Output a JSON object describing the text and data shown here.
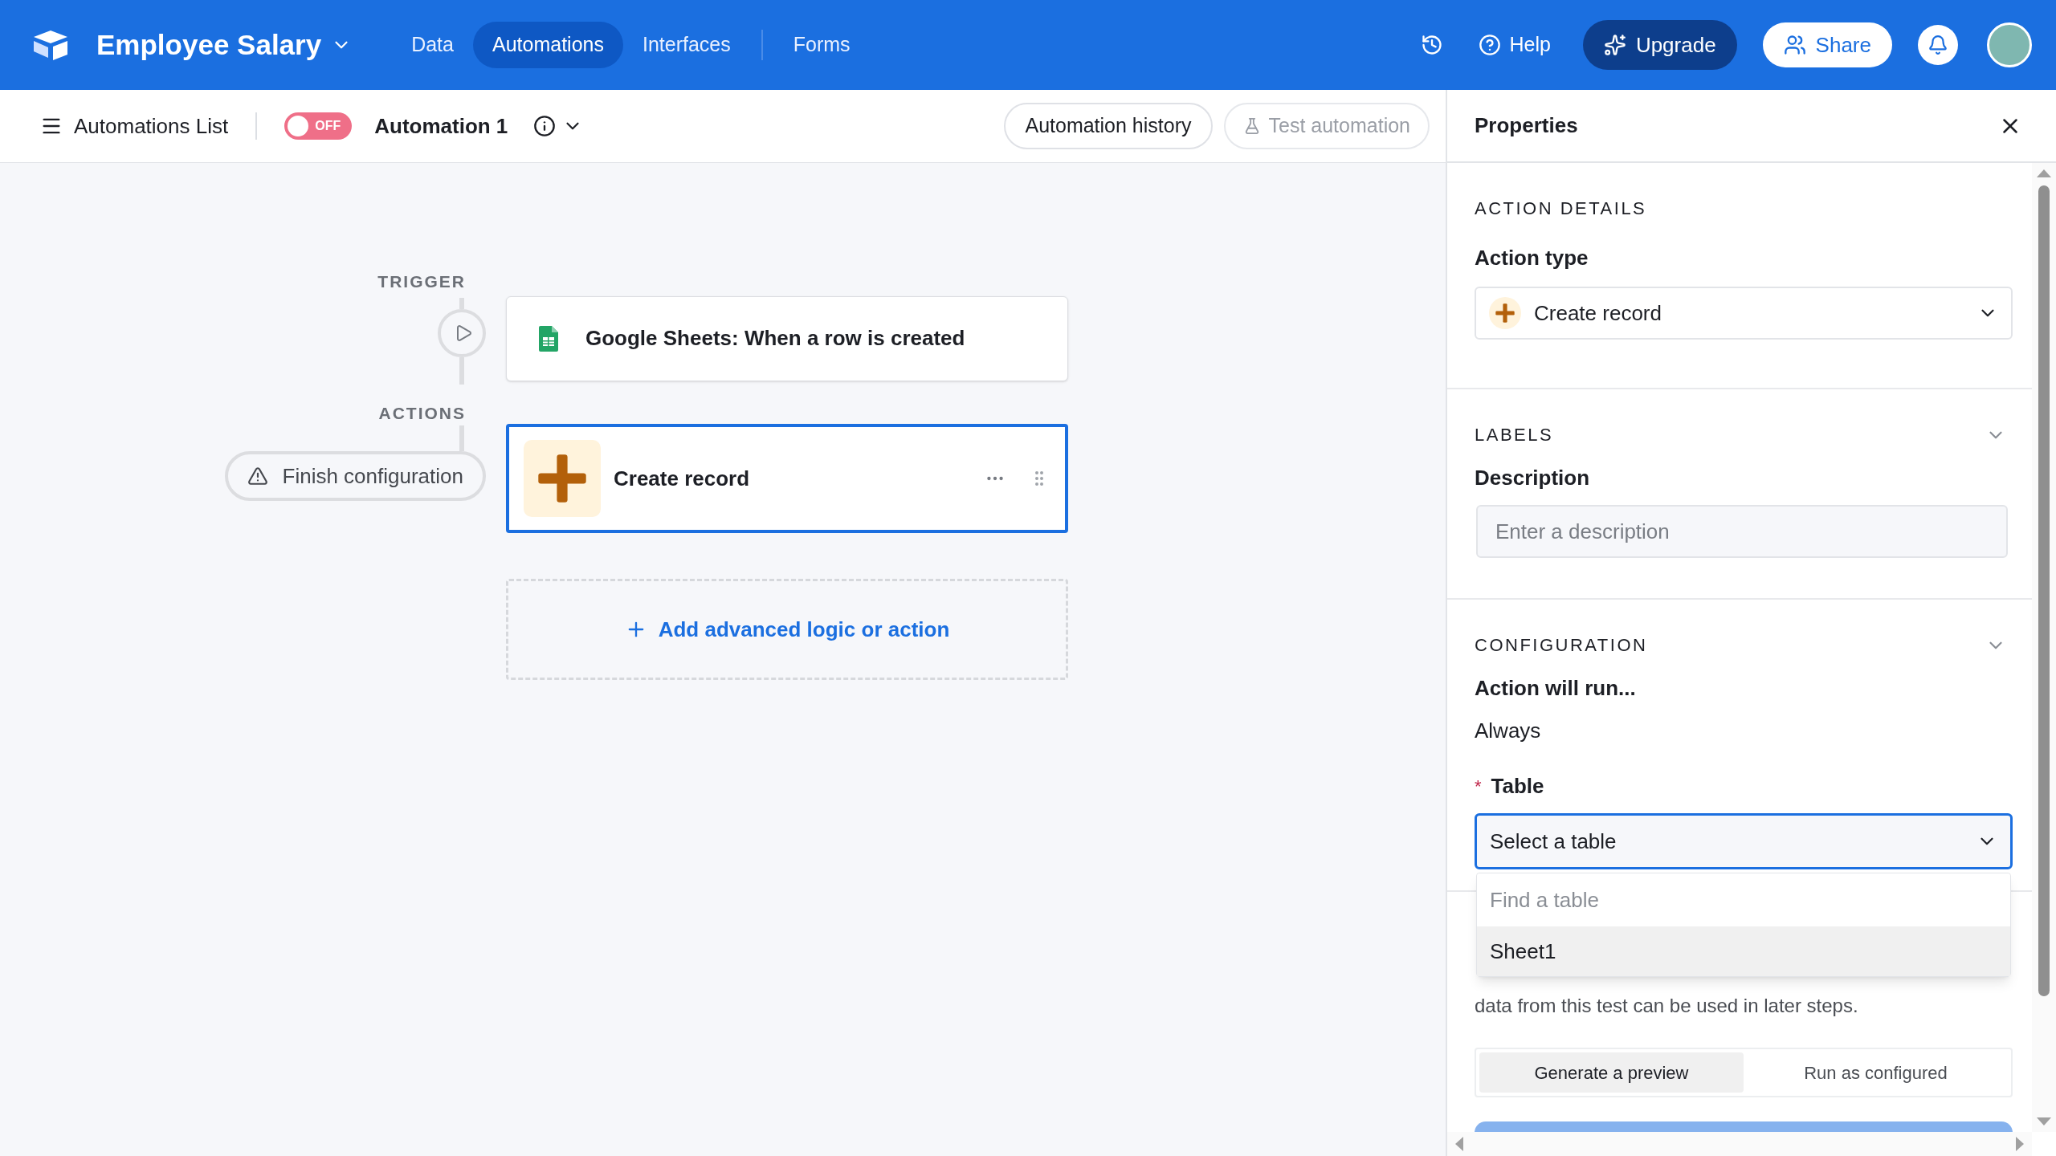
{
  "app_bar": {
    "title": "Employee Salary",
    "nav": [
      {
        "label": "Data",
        "selected": false
      },
      {
        "label": "Automations",
        "selected": true
      },
      {
        "label": "Interfaces",
        "selected": false
      },
      {
        "label": "Forms",
        "selected": false
      }
    ],
    "help": "Help",
    "upgrade": "Upgrade",
    "share": "Share"
  },
  "toolbar": {
    "list_button": "Automations List",
    "toggle": {
      "label": "OFF",
      "on": false
    },
    "name": "Automation 1",
    "history_button": "Automation history",
    "test_button": {
      "label": "Test automation",
      "disabled": true
    }
  },
  "canvas": {
    "trigger_label": "TRIGGER",
    "trigger": "Google Sheets: When a row is created",
    "actions_label": "ACTIONS",
    "warning": "Finish configuration",
    "actions": [
      {
        "label": "Create record",
        "selected": true
      }
    ],
    "add_button": "Add advanced logic or action"
  },
  "properties": {
    "title": "Properties",
    "action_details": {
      "heading": "ACTION DETAILS",
      "type_label": "Action type",
      "type_value": "Create record"
    },
    "labels": {
      "heading": "LABELS",
      "description_label": "Description",
      "description_placeholder": "Enter a description"
    },
    "configuration": {
      "heading": "CONFIGURATION",
      "run_label": "Action will run...",
      "run_value": "Always",
      "table_label": "Table",
      "required_mark": "*",
      "table_prompt": "Select a table",
      "dropdown": {
        "search_placeholder": "Find a table",
        "options": [
          {
            "label": "Sheet1",
            "highlighted": true
          }
        ]
      }
    },
    "test": {
      "text": "data from this test can be used in later steps.",
      "modes": [
        {
          "label": "Generate a preview",
          "selected": true
        },
        {
          "label": "Run as configured",
          "selected": false
        }
      ]
    }
  }
}
